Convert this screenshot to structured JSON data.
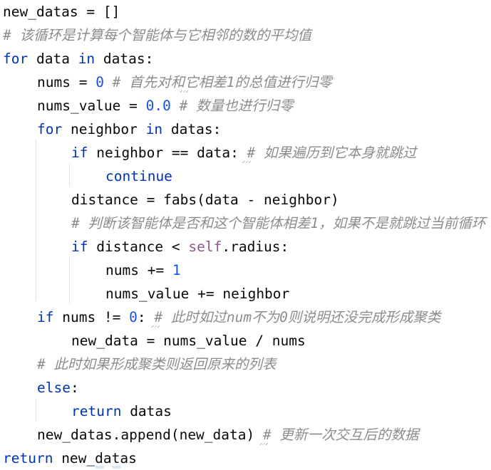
{
  "code": {
    "l1": {
      "text": "new_datas = []"
    },
    "l2": {
      "comment": "# 该循环是计算每个智能体与它相邻的数的平均值"
    },
    "l3": {
      "kw_for": "for",
      "t1": " data ",
      "kw_in": "in",
      "t2": " datas:"
    },
    "l4": {
      "t1": "nums = ",
      "num": "0",
      "comment": " # 首先对和它相差1的总值进行归零"
    },
    "l5": {
      "t1": "nums_value = ",
      "num": "0.0",
      "comment": " # 数量也进行归零"
    },
    "l6": {
      "kw_for": "for",
      "t1": " neighbor ",
      "kw_in": "in",
      "t2": " datas:"
    },
    "l7": {
      "kw_if": "if",
      "t1": " neighbor == data: ",
      "comment": "# 如果遍历到它本身就跳过"
    },
    "l8": {
      "kw": "continue"
    },
    "l9": {
      "t1": "distance = fabs(data - neighbor)"
    },
    "l10": {
      "comment": "# 判断该智能体是否和这个智能体相差1，如果不是就跳过当前循环"
    },
    "l11": {
      "kw_if": "if",
      "t1": " distance < ",
      "self": "self",
      "t2": ".radius:"
    },
    "l12": {
      "t1": "nums += ",
      "num": "1"
    },
    "l13": {
      "t1": "nums_value += neighbor"
    },
    "l14": {
      "kw_if": "if",
      "t1": " nums != ",
      "num": "0",
      "t2": ": ",
      "comment": "# 此时如过num不为0则说明还没完成形成聚类"
    },
    "l15": {
      "t1": "new_data = nums_value / nums"
    },
    "l16": {
      "comment": "# 此时如果形成聚类则返回原来的列表"
    },
    "l17": {
      "kw": "else",
      "t1": ":"
    },
    "l18": {
      "kw": "return",
      "t1": " datas"
    },
    "l19": {
      "t1": "new_datas.append(new_data) ",
      "comment": "# 更新一次交互后的数据"
    },
    "l20": {
      "kw": "return",
      "t1": " new_datas"
    }
  },
  "colors": {
    "keyword": "#0033b3",
    "number": "#1750eb",
    "comment": "#8c8c8c",
    "self": "#94558d",
    "text": "#080808",
    "background": "#ffffff"
  }
}
